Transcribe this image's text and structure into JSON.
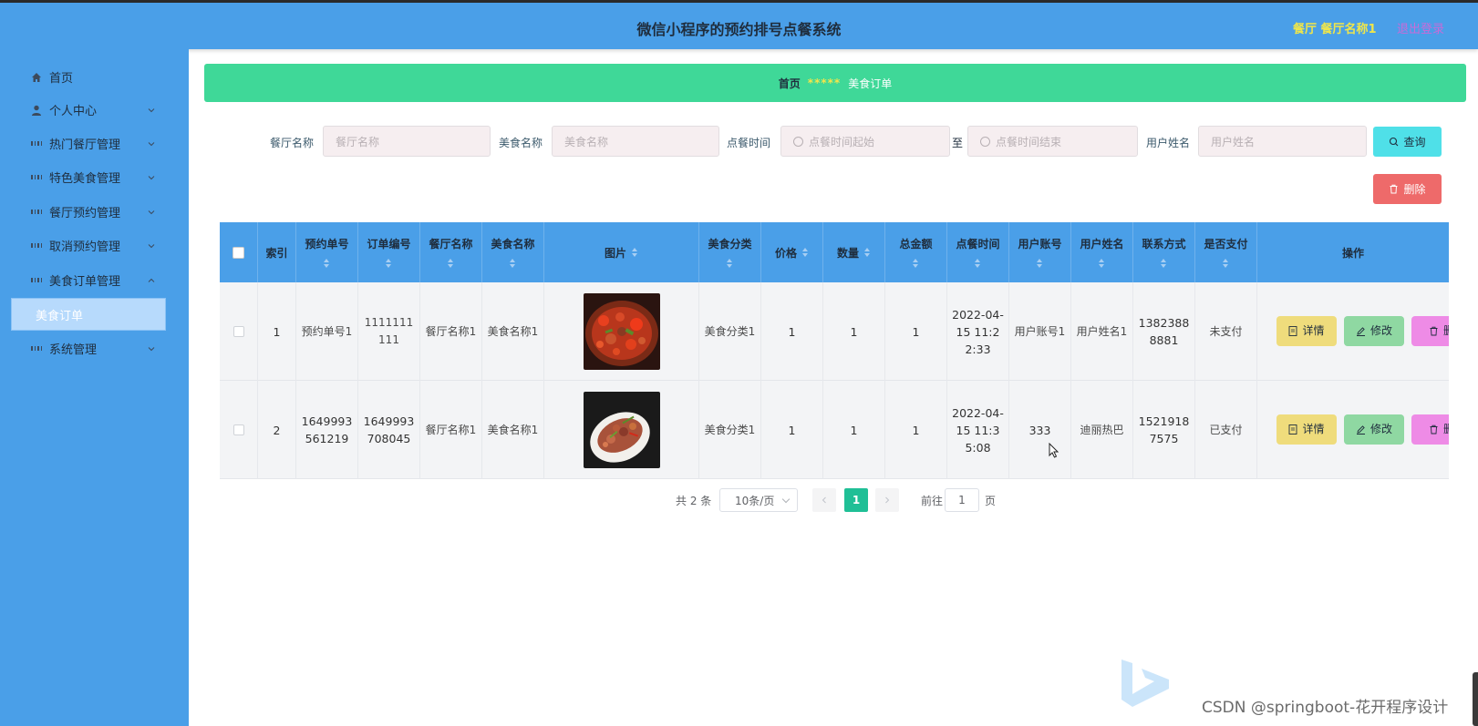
{
  "header": {
    "title": "微信小程序的预约排号点餐系统",
    "user": "餐厅 餐厅名称1",
    "logout": "退出登录"
  },
  "sidebar": {
    "items": [
      {
        "label": "首页",
        "icon": "home-icon"
      },
      {
        "label": "个人中心",
        "icon": "user-icon"
      },
      {
        "label": "热门餐厅管理",
        "icon": "grid-icon"
      },
      {
        "label": "特色美食管理",
        "icon": "grid-icon"
      },
      {
        "label": "餐厅预约管理",
        "icon": "grid-icon"
      },
      {
        "label": "取消预约管理",
        "icon": "grid-icon"
      },
      {
        "label": "美食订单管理",
        "icon": "grid-icon"
      },
      {
        "label": "系统管理",
        "icon": "grid-icon"
      }
    ],
    "active_sub": "美食订单"
  },
  "breadcrumb": {
    "home": "首页",
    "separator": "*****",
    "current": "美食订单"
  },
  "search": {
    "restaurant_label": "餐厅名称",
    "restaurant_placeholder": "餐厅名称",
    "food_label": "美食名称",
    "food_placeholder": "美食名称",
    "time_label": "点餐时间",
    "time_start_placeholder": "点餐时间起始",
    "to": "至",
    "time_end_placeholder": "点餐时间结束",
    "user_label": "用户姓名",
    "user_placeholder": "用户姓名",
    "query_button": "查询",
    "delete_button": "删除"
  },
  "table": {
    "headers": [
      "索引",
      "预约单号",
      "订单编号",
      "餐厅名称",
      "美食名称",
      "图片",
      "美食分类",
      "价格",
      "数量",
      "总金额",
      "点餐时间",
      "用户账号",
      "用户姓名",
      "联系方式",
      "是否支付",
      "操作"
    ],
    "rows": [
      {
        "index": "1",
        "booking_no": "预约单号1",
        "order_no": "1111111111",
        "restaurant": "餐厅名称1",
        "food": "美食名称1",
        "category": "美食分类1",
        "price": "1",
        "qty": "1",
        "total": "1",
        "time": "2022-04-15 11:22:33",
        "account": "用户账号1",
        "username": "用户姓名1",
        "phone": "13823888881",
        "paid": "未支付"
      },
      {
        "index": "2",
        "booking_no": "1649993561219",
        "order_no": "1649993708045",
        "restaurant": "餐厅名称1",
        "food": "美食名称1",
        "category": "美食分类1",
        "price": "1",
        "qty": "1",
        "total": "1",
        "time": "2022-04-15 11:35:08",
        "account": "333",
        "username": "迪丽热巴",
        "phone": "15219187575",
        "paid": "已支付"
      }
    ],
    "actions": {
      "detail": "详情",
      "edit": "修改",
      "delete": "删"
    }
  },
  "pagination": {
    "total": "共 2 条",
    "page_size": "10条/页",
    "current": "1",
    "goto": "前往",
    "goto_value": "1",
    "page_suffix": "页"
  },
  "watermark": "CSDN @springboot-花开程序设计",
  "colors": {
    "primary": "#4a9fe8",
    "breadcrumb": "#3fd898",
    "query": "#4fe0e8",
    "delete": "#ee6a6a",
    "detail": "#efdc7c",
    "edit": "#8fd8a2",
    "row_delete": "#ee8be6",
    "page_active": "#1fbf96"
  }
}
